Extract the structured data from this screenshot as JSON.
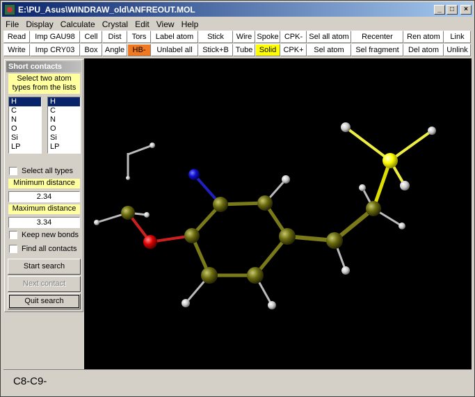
{
  "window": {
    "title": "E:\\PU_Asus\\WINDRAW_old\\ANFREOUT.MOL"
  },
  "menu": [
    "File",
    "Display",
    "Calculate",
    "Crystal",
    "Edit",
    "View",
    "Help"
  ],
  "toolbar": {
    "row1": [
      {
        "label": "Read",
        "w": 38
      },
      {
        "label": "Imp GAU98",
        "w": 72
      },
      {
        "label": "Cell",
        "w": 32
      },
      {
        "label": "Dist",
        "w": 36
      },
      {
        "label": "Tors",
        "w": 34
      },
      {
        "label": "Label atom",
        "w": 68
      },
      {
        "label": "Stick",
        "w": 50
      },
      {
        "label": "Wire",
        "w": 32
      },
      {
        "label": "Spoke",
        "w": 36
      },
      {
        "label": "CPK-",
        "w": 38
      },
      {
        "label": "Sel all atom",
        "w": 64
      },
      {
        "label": "Recenter",
        "w": 75
      },
      {
        "label": "Ren atom",
        "w": 58
      },
      {
        "label": "Link",
        "w": 39
      }
    ],
    "row2": [
      {
        "label": "Write",
        "w": 38
      },
      {
        "label": "Imp CRY03",
        "w": 72
      },
      {
        "label": "Box",
        "w": 32
      },
      {
        "label": "Angle",
        "w": 36
      },
      {
        "label": "HB-",
        "w": 34,
        "hl": "orange"
      },
      {
        "label": "Unlabel all",
        "w": 68
      },
      {
        "label": "Stick+B",
        "w": 50
      },
      {
        "label": "Tube",
        "w": 32
      },
      {
        "label": "Solid",
        "w": 36,
        "hl": "yellow"
      },
      {
        "label": "CPK+",
        "w": 38
      },
      {
        "label": "Sel atom",
        "w": 64
      },
      {
        "label": "Sel fragment",
        "w": 75
      },
      {
        "label": "Del atom",
        "w": 58
      },
      {
        "label": "Unlink",
        "w": 39
      }
    ]
  },
  "panel": {
    "title": "Short contacts",
    "instruction": "Select two atom types from the lists",
    "list_a": [
      "H",
      "C",
      "N",
      "O",
      "Si",
      "LP"
    ],
    "list_b": [
      "H",
      "C",
      "N",
      "O",
      "Si",
      "LP"
    ],
    "select_all_label": "Select all types",
    "min_label": "Minimum distance",
    "min_value": "2.34",
    "max_label": "Maximum distance",
    "max_value": "3.34",
    "keep_bonds_label": "Keep new bonds",
    "find_all_label": "Find all contacts",
    "start_label": "Start search",
    "next_label": "Next contact",
    "quit_label": "Quit  search"
  },
  "colors": {
    "carbon": "#6b6b10",
    "hydrogen": "#d8d8d8",
    "oxygen": "#e00000",
    "nitrogen": "#1010d0",
    "silicon": "#ffff00"
  },
  "status": {
    "text": "C8-C9-"
  }
}
